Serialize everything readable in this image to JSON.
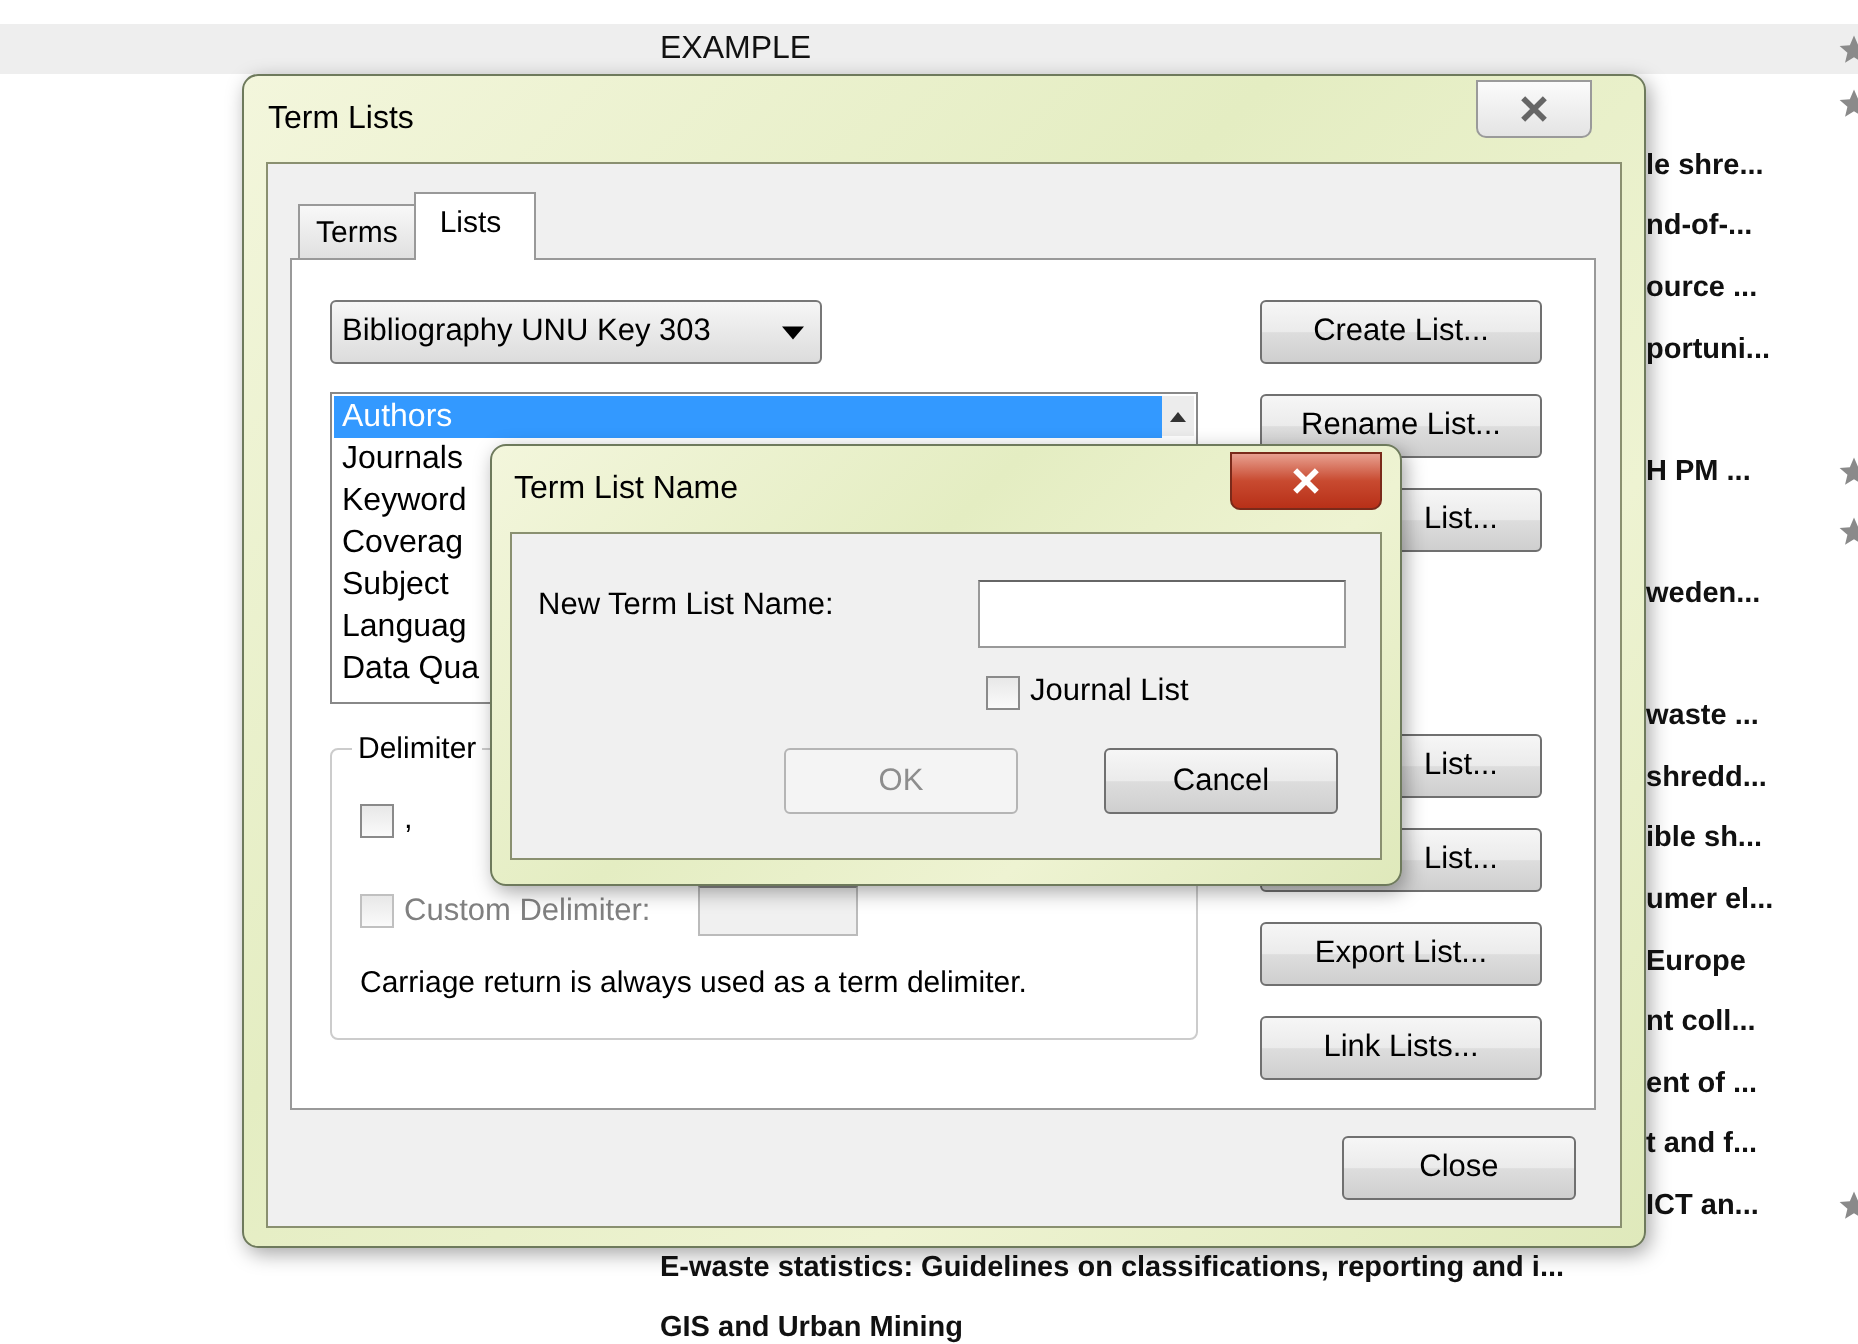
{
  "page": {
    "header": "EXAMPLE",
    "header_starred": true,
    "rows": [
      {
        "starred": true
      },
      {
        "title": "le shre...",
        "kind": "partial",
        "starred": false
      },
      {
        "title": "nd-of-...",
        "kind": "partial",
        "starred": false
      },
      {
        "title": "ource ...",
        "kind": "partial",
        "starred": false
      },
      {
        "title": "portuni...",
        "kind": "partial",
        "starred": false
      },
      {
        "starred": false
      },
      {
        "title": "H PM ...",
        "kind": "partial",
        "starred": true
      },
      {
        "starred": true
      },
      {
        "title": "weden...",
        "kind": "partial",
        "starred": false
      },
      {
        "starred": false
      },
      {
        "title": "waste ...",
        "kind": "partial",
        "starred": false
      },
      {
        "title": "shredd...",
        "kind": "partial",
        "starred": false
      },
      {
        "title": "ible sh...",
        "kind": "partial",
        "starred": false
      },
      {
        "title": "umer el...",
        "kind": "partial",
        "starred": false
      },
      {
        "title": "Europe",
        "kind": "partial",
        "starred": false
      },
      {
        "title": "nt coll...",
        "kind": "partial",
        "starred": false
      },
      {
        "title": "ent of ...",
        "kind": "partial",
        "starred": false
      },
      {
        "title": "t and f...",
        "kind": "partial",
        "starred": false
      },
      {
        "title": "ICT an...",
        "kind": "partial",
        "starred": true
      },
      {
        "title": "E-waste statistics: Guidelines on classifications, reporting and i...",
        "kind": "full",
        "starred": false
      },
      {
        "title": "GIS and Urban Mining",
        "kind": "full",
        "starred": false
      }
    ]
  },
  "term_lists_dialog": {
    "title": "Term Lists",
    "tabs": [
      {
        "label": "Terms",
        "selected": false
      },
      {
        "label": "Lists",
        "selected": true
      }
    ],
    "library_dropdown": "Bibliography UNU Key 303",
    "lists": [
      {
        "label": "Authors",
        "selected": true
      },
      {
        "label": "Journals",
        "selected": false
      },
      {
        "label": "Keyword",
        "selected": false
      },
      {
        "label": "Coverag",
        "selected": false
      },
      {
        "label": "Subject",
        "selected": false
      },
      {
        "label": "Languag",
        "selected": false
      },
      {
        "label": "Data Qua",
        "selected": false
      }
    ],
    "buttons_top": [
      {
        "label": "Create List...",
        "kind": "full"
      },
      {
        "label": "Rename List...",
        "kind": "full"
      },
      {
        "label": "List...",
        "kind": "covered"
      }
    ],
    "buttons_bottom": [
      {
        "label": "List...",
        "kind": "covered"
      },
      {
        "label": "List...",
        "kind": "covered"
      },
      {
        "label": "Export List...",
        "kind": "full"
      },
      {
        "label": "Link Lists...",
        "kind": "full"
      }
    ],
    "delimiters": {
      "legend": "Delimiter",
      "comma_option": {
        "label": ",",
        "checked": false
      },
      "custom_option": {
        "label": "Custom Delimiter:",
        "checked": false,
        "disabled": true
      },
      "note": "Carriage return is always used as a term delimiter."
    },
    "close_button": "Close"
  },
  "name_dialog": {
    "title": "Term List Name",
    "field_label": "New Term List Name:",
    "journal_list": {
      "label": "Journal List",
      "checked": false
    },
    "ok": {
      "label": "OK",
      "disabled": true
    },
    "cancel": {
      "label": "Cancel",
      "disabled": false
    }
  }
}
